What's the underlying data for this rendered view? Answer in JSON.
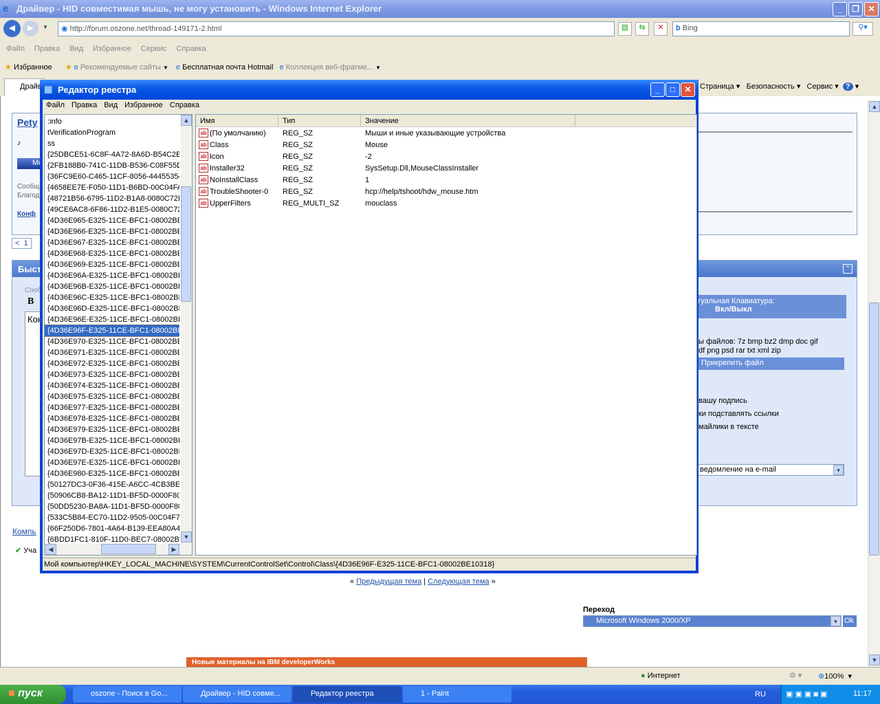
{
  "ie": {
    "title": "Драйвер - HID совместимая мышь, не могу установить - Windows Internet Explorer",
    "url": "http://forum.oszone.net/thread-149171-2.html",
    "search_placeholder": "Bing",
    "menu": [
      "Файл",
      "Правка",
      "Вид",
      "Избранное",
      "Сервис",
      "Справка"
    ],
    "favorites": {
      "label": "Избранное",
      "items": [
        "Рекомендуемые сайты",
        "Бесплатная почта Hotmail",
        "Коллекция веб-фрагме..."
      ]
    },
    "tab": "Драйв",
    "cmdbar": [
      "Страница",
      "Безопасность",
      "Сервис"
    ],
    "status": {
      "zone": "Интернет",
      "zoom": "100%"
    }
  },
  "forum": {
    "user": "Pety",
    "note": "♪",
    "btn": "Мо",
    "msg1": "Сообщ",
    "msg2": "Благод",
    "konf": "Конф",
    "pager": [
      "<",
      "1"
    ],
    "quick": "Быст",
    "msg_legend": "Сооб",
    "bold": "B",
    "text": "Кон",
    "komp": "Компь",
    "uch": "Уча",
    "vk": "туальная Клавиатура:",
    "vk_toggle": "Вкл/Выкл",
    "types1": "ы файлов: 7z bmp bz2 dmp doc gif",
    "types2": "df png psd rar txt xml zip",
    "attach": "Прикрепить файл",
    "opt1": "вашу подпись",
    "opt2": "ки подставлять ссылки",
    "opt3": "майлики в тексте",
    "notify": "ведомление на e-mail",
    "prev": "Предыдущая тема",
    "next": "Следующая тема",
    "goto": "Переход",
    "goto_value": "Microsoft Windows 2000/XP",
    "ok": "Ok",
    "ibm": "Новые материалы на IBM developerWorks"
  },
  "regedit": {
    "title": "Редактор реестра",
    "menu": [
      "Файл",
      "Правка",
      "Вид",
      "Избранное",
      "Справка"
    ],
    "tree": [
      ":info",
      "tVerificationProgram",
      "ss",
      "{25DBCE51-6C8F-4A72-8A6D-B54C2B4F",
      "{2FB188B0-741C-11DB-B536-C08F55D8",
      "{36FC9E60-C465-11CF-8056-444553540",
      "{4658EE7E-F050-11D1-B6BD-00C04FA3",
      "{48721B56-6795-11D2-B1A8-0080C72E",
      "{49CE6AC8-6F86-11D2-B1E5-0080C72E",
      "{4D36E965-E325-11CE-BFC1-08002BE10",
      "{4D36E966-E325-11CE-BFC1-08002BE10",
      "{4D36E967-E325-11CE-BFC1-08002BE10",
      "{4D36E968-E325-11CE-BFC1-08002BE10",
      "{4D36E969-E325-11CE-BFC1-08002BE10",
      "{4D36E96A-E325-11CE-BFC1-08002BE1",
      "{4D36E96B-E325-11CE-BFC1-08002BE10",
      "{4D36E96C-E325-11CE-BFC1-08002BE1",
      "{4D36E96D-E325-11CE-BFC1-08002BE1",
      "{4D36E96E-E325-11CE-BFC1-08002BE10",
      "{4D36E96F-E325-11CE-BFC1-08002BE10",
      "{4D36E970-E325-11CE-BFC1-08002BE10",
      "{4D36E971-E325-11CE-BFC1-08002BE10",
      "{4D36E972-E325-11CE-BFC1-08002BE10",
      "{4D36E973-E325-11CE-BFC1-08002BE10",
      "{4D36E974-E325-11CE-BFC1-08002BE10",
      "{4D36E975-E325-11CE-BFC1-08002BE10",
      "{4D36E977-E325-11CE-BFC1-08002BE10",
      "{4D36E978-E325-11CE-BFC1-08002BE10",
      "{4D36E979-E325-11CE-BFC1-08002BE10",
      "{4D36E97B-E325-11CE-BFC1-08002BE10",
      "{4D36E97D-E325-11CE-BFC1-08002BE1",
      "{4D36E97E-E325-11CE-BFC1-08002BE10",
      "{4D36E980-E325-11CE-BFC1-08002BE10",
      "{50127DC3-0F36-415E-A6CC-4CB3BE91",
      "{50906CB8-BA12-11D1-BF5D-0000F805",
      "{50DD5230-BA8A-11D1-BF5D-0000F805",
      "{533C5B84-EC70-11D2-9505-00C04F79",
      "{66F250D6-7801-4A64-B139-EEA80A45",
      "{6BDD1FC1-810F-11D0-BEC7-08002BE2"
    ],
    "selected_index": 19,
    "columns": [
      "Имя",
      "Тип",
      "Значение"
    ],
    "values": [
      {
        "name": "(По умолчанию)",
        "type": "REG_SZ",
        "data": "Мыши и иные указывающие устройства"
      },
      {
        "name": "Class",
        "type": "REG_SZ",
        "data": "Mouse"
      },
      {
        "name": "Icon",
        "type": "REG_SZ",
        "data": "-2"
      },
      {
        "name": "Installer32",
        "type": "REG_SZ",
        "data": "SysSetup.Dll,MouseClassInstaller"
      },
      {
        "name": "NoInstallClass",
        "type": "REG_SZ",
        "data": "1"
      },
      {
        "name": "TroubleShooter-0",
        "type": "REG_SZ",
        "data": "hcp://help/tshoot/hdw_mouse.htm"
      },
      {
        "name": "UpperFilters",
        "type": "REG_MULTI_SZ",
        "data": "mouclass"
      }
    ],
    "status": "Мой компьютер\\HKEY_LOCAL_MACHINE\\SYSTEM\\CurrentControlSet\\Control\\Class\\{4D36E96F-E325-11CE-BFC1-08002BE10318}"
  },
  "taskbar": {
    "start": "пуск",
    "tasks": [
      "oszone - Поиск в Go...",
      "Драйвер - HID совме...",
      "Редактор реестра",
      "1 - Paint"
    ],
    "active_index": 2,
    "lang": "RU",
    "clock": "11:17"
  }
}
